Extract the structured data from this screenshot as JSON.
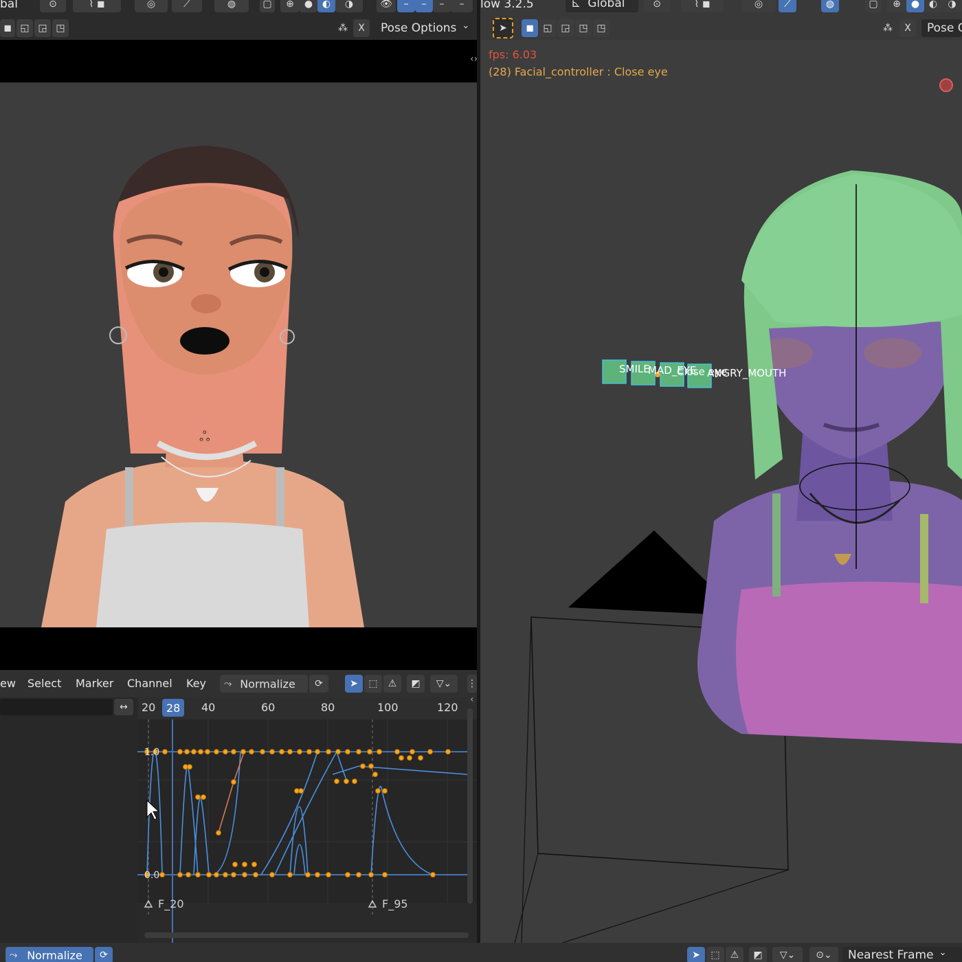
{
  "top_left_header": {
    "transform_orientation": "bal",
    "pose_options_label": "Pose Options",
    "close_label": "X"
  },
  "top_right_header": {
    "version_label": "low 3.2.5",
    "transform_orientation": "Global",
    "pose_options_label": "Pose O",
    "close_label": "X"
  },
  "right_viewport": {
    "fps_text": "fps: 6.03",
    "object_info": "(28) Facial_controller : Close eye",
    "bone_labels": [
      "SMILE",
      "MAD_EYE",
      "Close eye",
      "ANGRY_MOUTH"
    ],
    "colors": {
      "fps": "#e2543c",
      "info": "#e8a84a",
      "hair": "#7fc98a",
      "skin": "#7d64a8",
      "top": "#b86ab6"
    }
  },
  "graph_editor": {
    "menu": [
      "ew",
      "Select",
      "Marker",
      "Channel",
      "Key"
    ],
    "normalize_label": "Normalize",
    "current_frame": "28",
    "frame_ticks": [
      "20",
      "40",
      "60",
      "80",
      "100",
      "120"
    ],
    "y_labels": [
      "1.0",
      "0.0"
    ],
    "markers": [
      "F_20",
      "F_95"
    ],
    "colors": {
      "curve": "#4a90e2",
      "keys": "#f5a623",
      "playhead": "#4772b3"
    }
  },
  "status_bar": {
    "normalize_label": "Normalize",
    "snap_label": "Nearest Frame"
  },
  "icons": [
    "arrow-cursor-icon",
    "snap-magnet-icon",
    "filter-icon",
    "proportional-edit-icon",
    "overlay-icon",
    "shading-solid-icon",
    "shading-material-icon",
    "shading-rendered-icon",
    "wireframe-icon",
    "select-box-icon",
    "eye-icon",
    "refresh-icon",
    "warning-icon",
    "graph-curve-icon",
    "marker-triangle-icon",
    "record-icon"
  ]
}
